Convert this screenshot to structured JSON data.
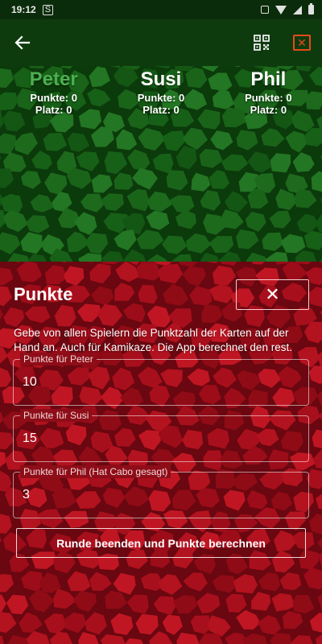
{
  "status_bar": {
    "time": "19:12",
    "left_icon": "S",
    "icons": [
      "vibrate-icon",
      "wifi-icon",
      "signal-icon",
      "battery-icon"
    ]
  },
  "app_bar": {
    "back_icon": "arrow-left-icon",
    "qr_icon": "qr-code-icon",
    "close_icon": "close-box-icon",
    "close_glyph": "✕"
  },
  "colors": {
    "green_dark": "#0e3b0e",
    "green_stone": "#125a12",
    "red_stone": "#8e0d18",
    "active_player": "#4caf50",
    "close_accent": "#e64a19"
  },
  "players": [
    {
      "name": "Peter",
      "points": "Punkte: 0",
      "place": "Platz: 0",
      "active": true
    },
    {
      "name": "Susi",
      "points": "Punkte: 0",
      "place": "Platz: 0",
      "active": false
    },
    {
      "name": "Phil",
      "points": "Punkte: 0",
      "place": "Platz: 0",
      "active": false
    }
  ],
  "panel": {
    "title": "Punkte",
    "close_glyph": "✕",
    "instructions": "Gebe von allen Spielern die Punktzahl der Karten auf der Hand an. Auch für Kamikaze. Die App berechnet den rest.",
    "fields": [
      {
        "label": "Punkte für Peter",
        "value": "10"
      },
      {
        "label": "Punkte für Susi",
        "value": "15"
      },
      {
        "label": "Punkte für Phil  (Hat Cabo gesagt)",
        "value": "3"
      }
    ],
    "submit_label": "Runde beenden und Punkte berechnen"
  }
}
